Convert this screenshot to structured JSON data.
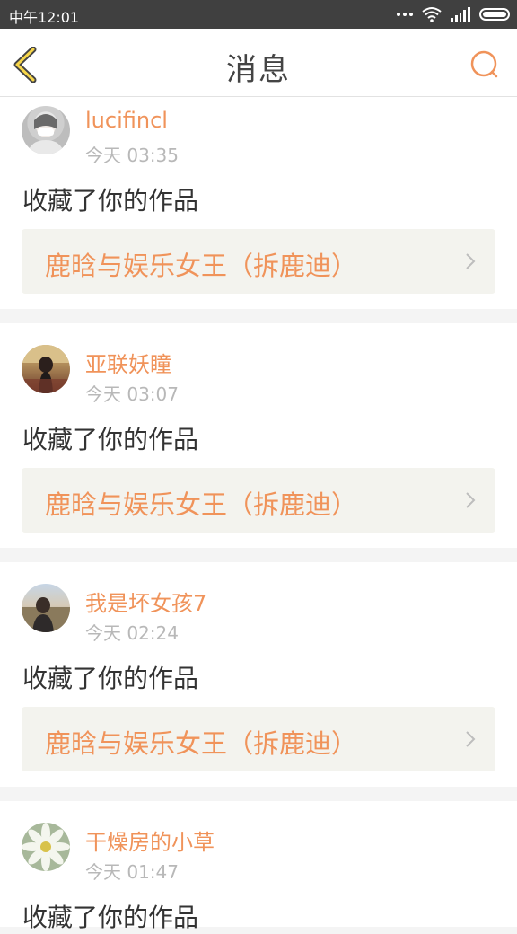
{
  "status_bar": {
    "time": "中午12:01"
  },
  "header": {
    "title": "消息"
  },
  "colors": {
    "accent": "#f0935a",
    "back_arrow_fill": "#f7d64a",
    "card_link_bg": "#f3f3ee"
  },
  "notifications": [
    {
      "user": "lucifincl",
      "time": "今天 03:35",
      "action": "收藏了你的作品",
      "work": "鹿晗与娱乐女王（拆鹿迪）"
    },
    {
      "user": "亚联妖瞳",
      "time": "今天 03:07",
      "action": "收藏了你的作品",
      "work": "鹿晗与娱乐女王（拆鹿迪）"
    },
    {
      "user": "我是坏女孩7",
      "time": "今天 02:24",
      "action": "收藏了你的作品",
      "work": "鹿晗与娱乐女王（拆鹿迪）"
    },
    {
      "user": "干燥房的小草",
      "time": "今天 01:47",
      "action": "收藏了你的作品"
    }
  ]
}
